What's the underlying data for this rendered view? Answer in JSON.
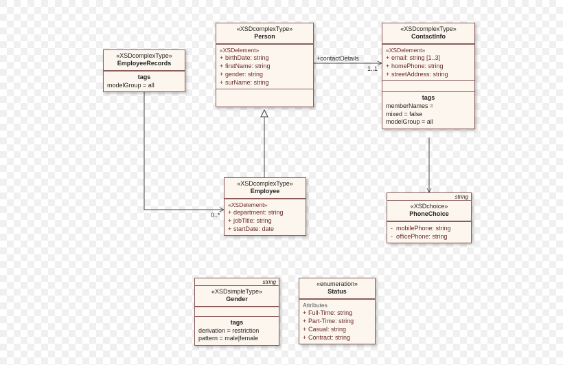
{
  "classes": {
    "employeeRecords": {
      "stereo": "«XSDcomplexType»",
      "name": "EmployeeRecords",
      "tagsTitle": "tags",
      "tags": [
        "modelGroup = all"
      ]
    },
    "person": {
      "stereo": "«XSDcomplexType»",
      "name": "Person",
      "elemStereo": "«XSDelement»",
      "attrs": [
        {
          "vis": "+",
          "text": "birthDate:  string"
        },
        {
          "vis": "+",
          "text": "firstName:  string"
        },
        {
          "vis": "+",
          "text": "gender:  string"
        },
        {
          "vis": "+",
          "text": "surName:  string"
        }
      ]
    },
    "contactInfo": {
      "stereo": "«XSDcomplexType»",
      "name": "ContactInfo",
      "elemStereo": "«XSDelement»",
      "attrs": [
        {
          "vis": "+",
          "text": "email:  string  [1..3]"
        },
        {
          "vis": "+",
          "text": "homePhone:  string"
        },
        {
          "vis": "+",
          "text": "streetAddress:  string"
        }
      ],
      "tagsTitle": "tags",
      "tags": [
        "memberNames =",
        "mixed = false",
        "modelGroup = all"
      ]
    },
    "employee": {
      "stereo": "«XSDcomplexType»",
      "name": "Employee",
      "elemStereo": "«XSDelement»",
      "attrs": [
        {
          "vis": "+",
          "text": "department:  string"
        },
        {
          "vis": "+",
          "text": "jobTitle:  string"
        },
        {
          "vis": "+",
          "text": "startDate:  date"
        }
      ]
    },
    "phoneChoice": {
      "role": "string",
      "stereo": "«XSDchoice»",
      "name": "PhoneChoice",
      "attrs": [
        {
          "vis": "-",
          "text": "mobilePhone:  string"
        },
        {
          "vis": "-",
          "text": "officePhone:  string"
        }
      ]
    },
    "gender": {
      "role": "string",
      "stereo": "«XSDsimpleType»",
      "name": "Gender",
      "tagsTitle": "tags",
      "tags": [
        "derivation = restriction",
        "pattern = male|female"
      ]
    },
    "status": {
      "stereo": "«enumeration»",
      "name": "Status",
      "attrHeader": "Attributes",
      "attrs": [
        {
          "vis": "+",
          "text": "Full-Time:  string"
        },
        {
          "vis": "+",
          "text": "Part-Time:  string"
        },
        {
          "vis": "+",
          "text": "Casual:  string"
        },
        {
          "vis": "+",
          "text": "Contract:  string"
        }
      ]
    }
  },
  "edges": {
    "contactDetails": {
      "label": "+contactDetails",
      "mult": "1..1"
    },
    "employeeMult": "0..*"
  }
}
